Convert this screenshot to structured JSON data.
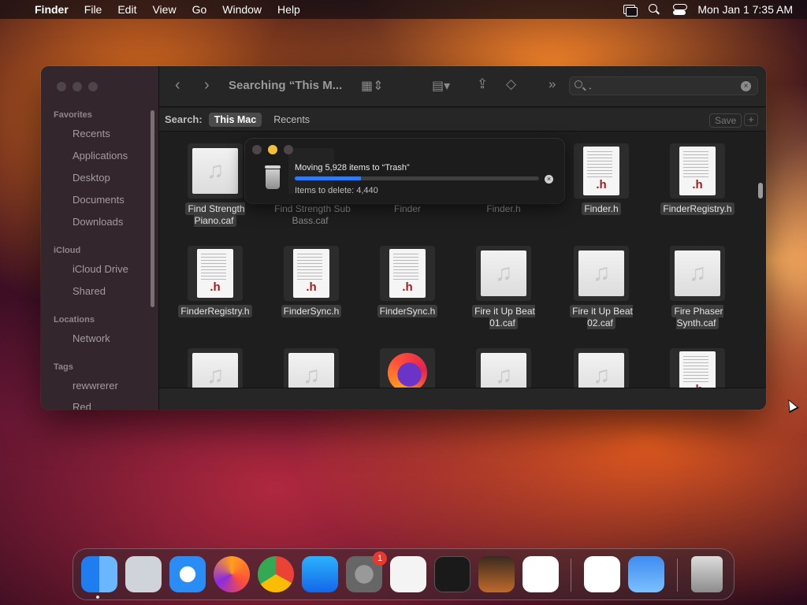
{
  "menubar": {
    "app_name": "Finder",
    "menus": [
      "File",
      "Edit",
      "View",
      "Go",
      "Window",
      "Help"
    ],
    "clock": "Mon Jan 1  7:35 AM"
  },
  "finder": {
    "title": "Searching “This M...",
    "search_query": ".",
    "sidebar": {
      "favorites_header": "Favorites",
      "favorites": [
        "Recents",
        "Applications",
        "Desktop",
        "Documents",
        "Downloads"
      ],
      "icloud_header": "iCloud",
      "icloud": [
        "iCloud Drive",
        "Shared"
      ],
      "locations_header": "Locations",
      "locations": [
        "Network"
      ],
      "tags_header": "Tags",
      "tags": [
        "rewwrerer",
        "Red"
      ]
    },
    "scope": {
      "label": "Search:",
      "this_mac": "This Mac",
      "recents": "Recents",
      "save": "Save",
      "plus": "+"
    },
    "files": [
      {
        "name": "Find Strength Piano.caf",
        "type": "caf"
      },
      {
        "name": "Find Strength Sub Bass.caf",
        "type": "caf"
      },
      {
        "name": "Finder",
        "type": "app"
      },
      {
        "name": "Finder.h",
        "type": "h"
      },
      {
        "name": "Finder.h",
        "type": "h"
      },
      {
        "name": "FinderRegistry.h",
        "type": "h"
      },
      {
        "name": "FinderRegistry.h",
        "type": "h"
      },
      {
        "name": "FinderSync.h",
        "type": "h"
      },
      {
        "name": "FinderSync.h",
        "type": "h"
      },
      {
        "name": "Fire it Up Beat 01.caf",
        "type": "caf"
      },
      {
        "name": "Fire it Up Beat 02.caf",
        "type": "caf"
      },
      {
        "name": "Fire Phaser Synth.caf",
        "type": "caf"
      }
    ],
    "file_ext_label": ".h",
    "music_glyph": "♫"
  },
  "progress": {
    "message": "Moving 5,928 items to “Trash”",
    "sub": "Items to delete: 4,440",
    "fraction": 0.27
  },
  "dock": {
    "badge_count": "1"
  }
}
